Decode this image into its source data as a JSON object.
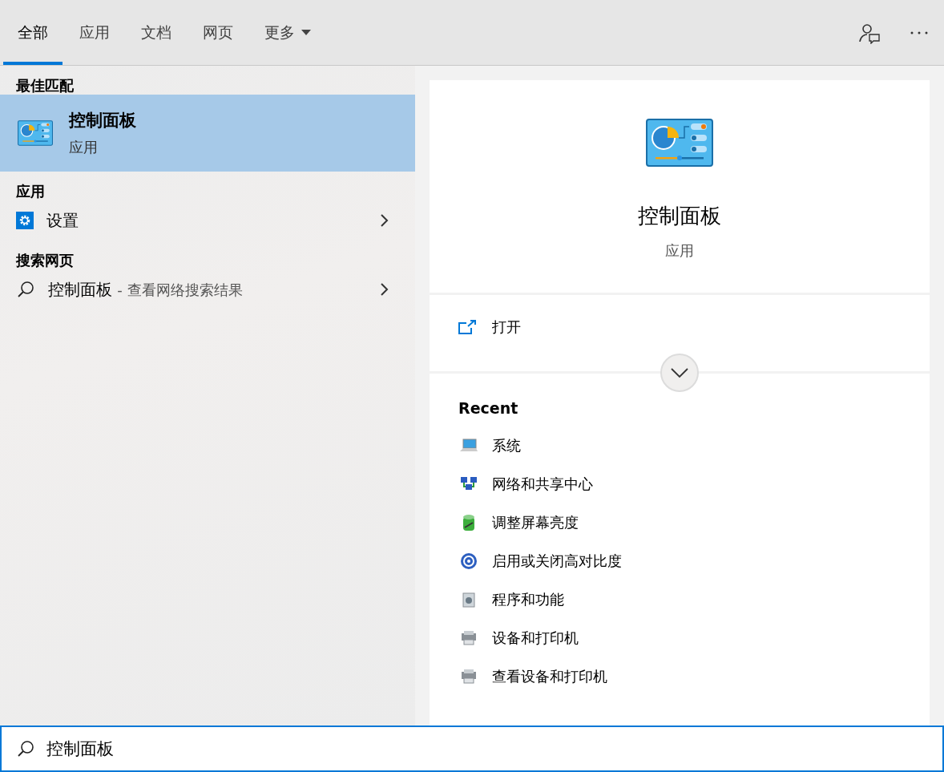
{
  "tabs": [
    {
      "label": "全部",
      "kind": "tab",
      "selected": true
    },
    {
      "label": "应用",
      "kind": "tab",
      "selected": false
    },
    {
      "label": "文档",
      "kind": "tab",
      "selected": false
    },
    {
      "label": "网页",
      "kind": "tab",
      "selected": false
    },
    {
      "label": "更多",
      "kind": "menu",
      "selected": false
    }
  ],
  "sections": [
    {
      "heading": "最佳匹配",
      "items": [
        {
          "kind": "best",
          "title": "控制面板",
          "subtitle": "应用",
          "selected": true
        }
      ]
    },
    {
      "heading": "应用",
      "items": [
        {
          "kind": "settings",
          "title": "设置",
          "selected": false
        }
      ]
    },
    {
      "heading": "搜索网页",
      "items": [
        {
          "kind": "web",
          "title": "控制面板",
          "suffix": "- 查看网络搜索结果",
          "selected": false
        }
      ]
    }
  ],
  "preview": {
    "title": "控制面板",
    "subtitle": "应用",
    "actions": [
      {
        "label": "打开"
      }
    ],
    "recent_heading": "Recent",
    "recent": [
      {
        "label": "系统",
        "kind": "system"
      },
      {
        "label": "网络和共享中心",
        "kind": "network"
      },
      {
        "label": "调整屏幕亮度",
        "kind": "brightness"
      },
      {
        "label": "启用或关闭高对比度",
        "kind": "contrast"
      },
      {
        "label": "程序和功能",
        "kind": "programs"
      },
      {
        "label": "设备和打印机",
        "kind": "devices"
      },
      {
        "label": "查看设备和打印机",
        "kind": "devices"
      }
    ]
  },
  "search": {
    "value": "控制面板"
  }
}
